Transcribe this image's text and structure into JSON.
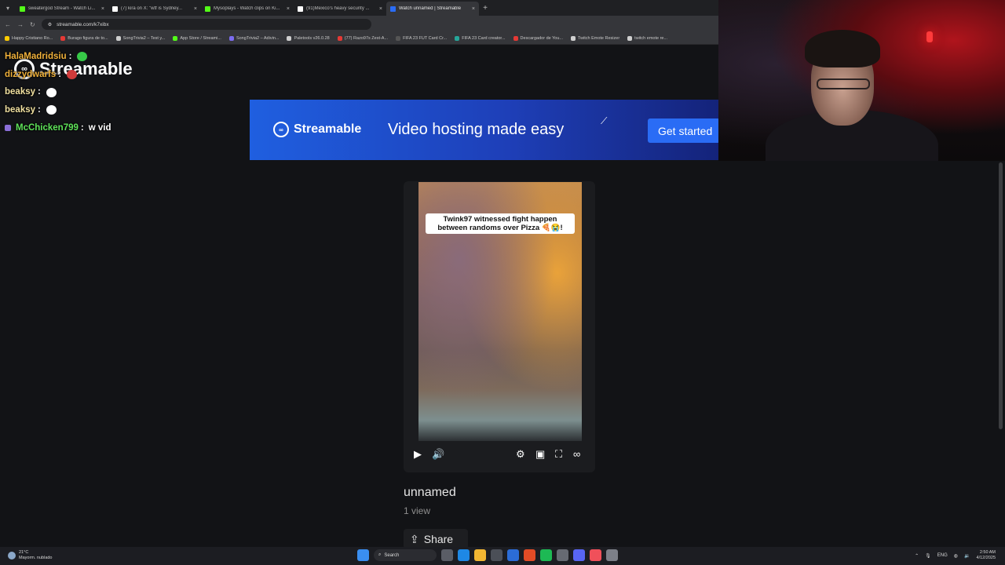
{
  "browser": {
    "tabs": [
      {
        "title": "sweatergod Stream - Watch Li...",
        "color": "#53fc18",
        "active": false
      },
      {
        "title": "(7) kira on X: \"wtf is Sydney...",
        "color": "#ffffff",
        "active": false
      },
      {
        "title": "Mysoplays - Watch clips on Ki...",
        "color": "#53fc18",
        "active": false
      },
      {
        "title": "(91)Mexico's heavy security ...",
        "color": "#ffffff",
        "active": false
      },
      {
        "title": "Watch unnamed | Streamable",
        "color": "#2a6cf5",
        "active": true
      }
    ],
    "close_glyph": "×",
    "new_tab_glyph": "+",
    "url": "streamable.com/k7xibx",
    "bookmarks": [
      {
        "label": "Happy Cristiano Ro...",
        "color": "#ffcc00"
      },
      {
        "label": "Burago figura de to...",
        "color": "#e53935"
      },
      {
        "label": "SongTrivia2 – Test y...",
        "color": "#cfcfcf"
      },
      {
        "label": "App Store / Streami...",
        "color": "#53fc18"
      },
      {
        "label": "SongTrivia2 – Adivin...",
        "color": "#7c6cf0"
      },
      {
        "label": "Paletools v26.0.28",
        "color": "#cfcfcf"
      },
      {
        "label": "(77) Razo97s Zest-A...",
        "color": "#e53935"
      },
      {
        "label": "FIFA 23 FUT Card Cr...",
        "color": "#555555"
      },
      {
        "label": "FIFA 23 Card creator...",
        "color": "#26a69a"
      },
      {
        "label": "Descargador de You...",
        "color": "#e53935"
      },
      {
        "label": "Twitch Emote Resizer",
        "color": "#cfcfcf"
      },
      {
        "label": "twitch emote re...",
        "color": "#cfcfcf"
      }
    ]
  },
  "page": {
    "logo_text": "Streamable",
    "banner": {
      "brand": "Streamable",
      "tagline": "Video hosting made easy",
      "cta": "Get started"
    },
    "video": {
      "caption": "Twink97 witnessed fight happen between randoms over Pizza 🍕😭!",
      "title": "unnamed",
      "views": "1 view",
      "share_label": "Share"
    }
  },
  "chat": [
    {
      "user": "HalaMadridsiu",
      "user_color": "#f0b13b",
      "text": "",
      "emote": "#37c948",
      "badge": false
    },
    {
      "user": "dizzydwarfs",
      "user_color": "#f0b13b",
      "text": "",
      "emote": "#d13b3b",
      "badge": false
    },
    {
      "user": "beaksy",
      "user_color": "#f0e0a0",
      "text": "",
      "emote": "#ffffff",
      "badge": false
    },
    {
      "user": "beaksy",
      "user_color": "#f0e0a0",
      "text": "",
      "emote": "#ffffff",
      "badge": false
    },
    {
      "user": "McChicken799",
      "user_color": "#5fe35a",
      "text": "w vid",
      "emote": "",
      "badge": true
    }
  ],
  "taskbar": {
    "weather_temp": "21°C",
    "weather_desc": "Mayorm. nublado",
    "search_label": "Search",
    "lang": "ENG",
    "time": "2:50 AM",
    "date": "4/12/2025"
  }
}
